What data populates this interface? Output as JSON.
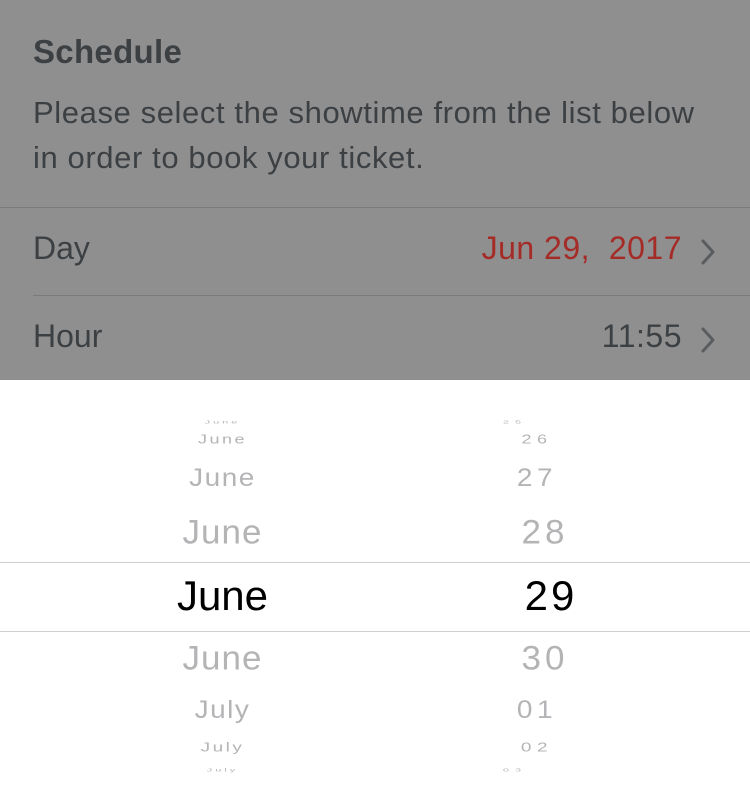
{
  "schedule": {
    "title": "Schedule",
    "description": "Please select the showtime from the list below in order to book your ticket."
  },
  "rows": {
    "day": {
      "label": "Day",
      "value": "Jun 29,  2017"
    },
    "hour": {
      "label": "Hour",
      "value": "11:55"
    }
  },
  "picker": {
    "months": [
      "June",
      "June",
      "June",
      "June",
      "June",
      "June",
      "July",
      "July",
      "July"
    ],
    "days": [
      "25",
      "26",
      "27",
      "28",
      "29",
      "30",
      "01",
      "02",
      "03"
    ],
    "selected_month": "June",
    "selected_day": "29"
  },
  "colors": {
    "overlay": "#8f8f90",
    "accent_red": "#a42b26",
    "text_dark": "#3c4043",
    "picker_faded": "#b4b4b7",
    "picker_selected": "#000000"
  },
  "icons": {
    "row_disclosure": "chevron-right-icon"
  }
}
